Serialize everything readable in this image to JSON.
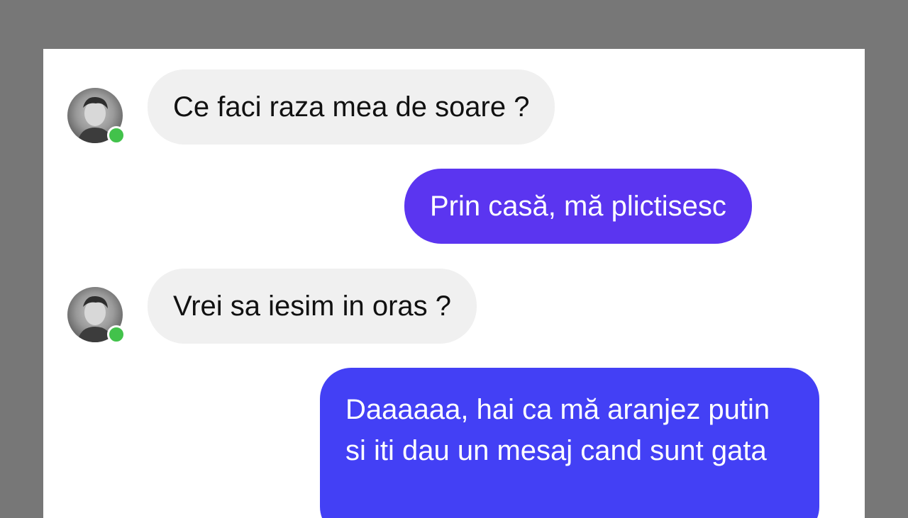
{
  "conversation": {
    "messages": [
      {
        "sender": "contact",
        "text": "Ce faci raza mea de soare ?"
      },
      {
        "sender": "me",
        "text": "Prin casă, mă plictisesc"
      },
      {
        "sender": "contact",
        "text": "Vrei sa iesim in oras ?"
      },
      {
        "sender": "me",
        "text": "Daaaaaa, hai ca mă aranjez putin si iti dau un mesaj cand sunt gata"
      }
    ]
  },
  "colors": {
    "page_background": "#777777",
    "panel_background": "#ffffff",
    "incoming_bubble": "#f0f0f0",
    "outgoing_bubble_1": "#5b35f0",
    "outgoing_bubble_2": "#4340f5",
    "online_indicator": "#42c24b"
  },
  "icons": {
    "avatar": "contact-avatar-photo",
    "status": "online-status-dot"
  }
}
